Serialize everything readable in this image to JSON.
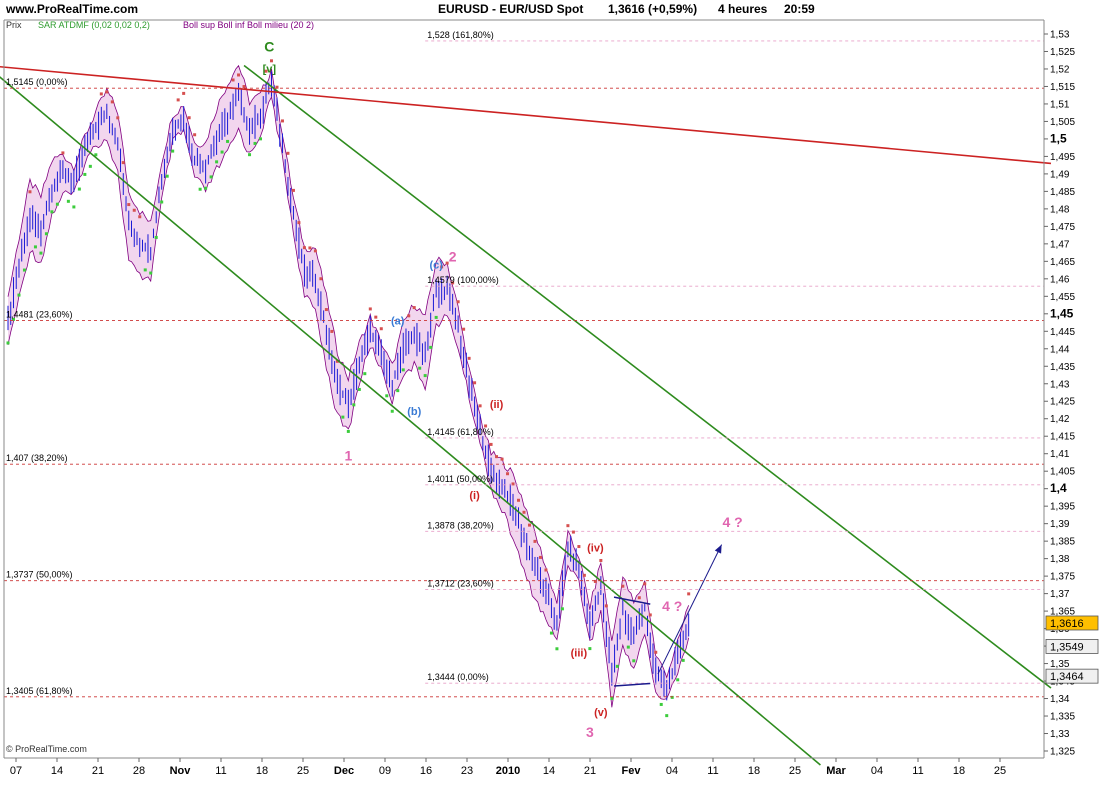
{
  "header": {
    "site": "www.ProRealTime.com",
    "instrument": "EURUSD - EUR/USD Spot",
    "quote": "1,3616 (+0,59%)",
    "timeframe": "4 heures",
    "time": "20:59"
  },
  "footer": {
    "copyright": "© ProRealTime.com"
  },
  "legend": {
    "price": "Prix",
    "sar": "SAR ATDMF (0,02 0,02 0,2)",
    "boll": "Boll sup Boll inf Boll milieu (20 2)"
  },
  "colors": {
    "candles": "#1a1ad6",
    "boll_fill": "#f2d6ee",
    "boll_line": "#800080",
    "sar_bear": "#d65050",
    "sar_bull": "#3ccc3c",
    "channel": "#2e8b1e",
    "resistance": "#cc2222",
    "fib_line": "#cc3333",
    "wave_pink": "#e066b0",
    "wave_red": "#cc2222",
    "wave_blue": "#3a7bd5",
    "wave_green": "#2e8b1e",
    "arrow": "#1a1a8c"
  },
  "chart_data": {
    "type": "candlestick",
    "title": "EURUSD - EUR/USD Spot",
    "x_ticks": [
      "07",
      "14",
      "21",
      "28",
      "Nov",
      "11",
      "18",
      "25",
      "Dec",
      "09",
      "16",
      "23",
      "2010",
      "14",
      "21",
      "Fev",
      "04",
      "11",
      "18",
      "25",
      "Mar",
      "04",
      "11",
      "18",
      "25"
    ],
    "y_ticks": [
      "1,53",
      "1,525",
      "1,52",
      "1,515",
      "1,51",
      "1,505",
      "1,5",
      "1,495",
      "1,49",
      "1,485",
      "1,48",
      "1,475",
      "1,47",
      "1,465",
      "1,46",
      "1,455",
      "1,45",
      "1,445",
      "1,44",
      "1,435",
      "1,43",
      "1,425",
      "1,42",
      "1,415",
      "1,41",
      "1,405",
      "1,4",
      "1,395",
      "1,39",
      "1,385",
      "1,38",
      "1,375",
      "1,37",
      "1,365",
      "1,36",
      "1,355",
      "1,35",
      "1,345",
      "1,34",
      "1,335",
      "1,33",
      "1,325"
    ],
    "y_bold_ticks": [
      "1,5",
      "1,45",
      "1,4"
    ],
    "ylim": [
      1.323,
      1.534
    ],
    "grid": false,
    "price_path": [
      [
        0,
        1.448
      ],
      [
        1,
        1.463
      ],
      [
        2,
        1.478
      ],
      [
        3,
        1.474
      ],
      [
        4,
        1.486
      ],
      [
        5,
        1.49
      ],
      [
        6,
        1.488
      ],
      [
        7,
        1.497
      ],
      [
        8,
        1.503
      ],
      [
        9,
        1.507
      ],
      [
        10,
        1.499
      ],
      [
        11,
        1.475
      ],
      [
        12,
        1.47
      ],
      [
        13,
        1.468
      ],
      [
        14,
        1.488
      ],
      [
        15,
        1.503
      ],
      [
        16,
        1.506
      ],
      [
        17,
        1.494
      ],
      [
        18,
        1.492
      ],
      [
        19,
        1.5
      ],
      [
        20,
        1.506
      ],
      [
        21,
        1.512
      ],
      [
        22,
        1.503
      ],
      [
        23,
        1.507
      ],
      [
        24,
        1.516
      ],
      [
        25,
        1.498
      ],
      [
        26,
        1.478
      ],
      [
        27,
        1.462
      ],
      [
        28,
        1.46
      ],
      [
        29,
        1.445
      ],
      [
        30,
        1.43
      ],
      [
        31,
        1.424
      ],
      [
        32,
        1.436
      ],
      [
        33,
        1.445
      ],
      [
        34,
        1.438
      ],
      [
        35,
        1.43
      ],
      [
        36,
        1.44
      ],
      [
        37,
        1.444
      ],
      [
        38,
        1.439
      ],
      [
        39,
        1.456
      ],
      [
        40,
        1.457
      ],
      [
        41,
        1.446
      ],
      [
        42,
        1.43
      ],
      [
        43,
        1.417
      ],
      [
        44,
        1.405
      ],
      [
        45,
        1.401
      ],
      [
        46,
        1.395
      ],
      [
        47,
        1.386
      ],
      [
        48,
        1.378
      ],
      [
        49,
        1.37
      ],
      [
        50,
        1.362
      ],
      [
        51,
        1.383
      ],
      [
        52,
        1.377
      ],
      [
        53,
        1.361
      ],
      [
        54,
        1.372
      ],
      [
        55,
        1.347
      ],
      [
        56,
        1.365
      ],
      [
        57,
        1.358
      ],
      [
        58,
        1.366
      ],
      [
        59,
        1.347
      ],
      [
        60,
        1.343
      ],
      [
        61,
        1.352
      ],
      [
        62,
        1.362
      ]
    ],
    "price_path_end_index": 62,
    "lines": [
      {
        "name": "channel-upper",
        "kind": "channel",
        "from": [
          21.5,
          1.521
        ],
        "to": [
          95,
          1.343
        ]
      },
      {
        "name": "channel-lower",
        "kind": "channel",
        "from": [
          -2,
          1.521
        ],
        "to": [
          74,
          1.321
        ]
      },
      {
        "name": "resistance",
        "kind": "resistance",
        "from": [
          -2,
          1.521
        ],
        "to": [
          95,
          1.493
        ]
      }
    ],
    "fib_left": [
      {
        "label": "1,5145 (0,00%)",
        "y": 1.5145
      },
      {
        "label": "1,4481 (23,60%)",
        "y": 1.4481
      },
      {
        "label": "1,407 (38,20%)",
        "y": 1.407
      },
      {
        "label": "1,3737 (50,00%)",
        "y": 1.3737
      },
      {
        "label": "1,3405 (61,80%)",
        "y": 1.3405
      }
    ],
    "fib_right": [
      {
        "label": "1,528 (161,80%)",
        "y": 1.528
      },
      {
        "label": "1,4579 (100,00%)",
        "y": 1.4579
      },
      {
        "label": "1,4145 (61,80%)",
        "y": 1.4145
      },
      {
        "label": "1,4011 (50,00%)",
        "y": 1.4011
      },
      {
        "label": "1,3878 (38,20%)",
        "y": 1.3878
      },
      {
        "label": "1,3712 (23,60%)",
        "y": 1.3712
      },
      {
        "label": "1,3444 (0,00%)",
        "y": 1.3444
      }
    ],
    "wave_labels": [
      {
        "text": "C",
        "color": "green",
        "x": 23.8,
        "y": 1.525
      },
      {
        "text": "[v]",
        "color": "green",
        "x": 23.8,
        "y": 1.519
      },
      {
        "text": "(a)",
        "color": "blue",
        "x": 35.5,
        "y": 1.447
      },
      {
        "text": "(b)",
        "color": "blue",
        "x": 37,
        "y": 1.421
      },
      {
        "text": "(c)",
        "color": "blue",
        "x": 39,
        "y": 1.463
      },
      {
        "text": "2",
        "color": "pink",
        "x": 40.5,
        "y": 1.465
      },
      {
        "text": "1",
        "color": "pink",
        "x": 31,
        "y": 1.408
      },
      {
        "text": "(ii)",
        "color": "red",
        "x": 44.5,
        "y": 1.423
      },
      {
        "text": "(i)",
        "color": "red",
        "x": 42.5,
        "y": 1.397
      },
      {
        "text": "(iv)",
        "color": "red",
        "x": 53.5,
        "y": 1.382
      },
      {
        "text": "(iii)",
        "color": "red",
        "x": 52,
        "y": 1.352
      },
      {
        "text": "(v)",
        "color": "red",
        "x": 54,
        "y": 1.335
      },
      {
        "text": "3",
        "color": "pink",
        "x": 53,
        "y": 1.329
      },
      {
        "text": "4 ?",
        "color": "pink",
        "x": 60.5,
        "y": 1.365
      },
      {
        "text": "4 ?",
        "color": "pink",
        "x": 66,
        "y": 1.389
      }
    ],
    "last_values": [
      {
        "label": "1,3616",
        "y": 1.3616
      },
      {
        "label": "1,3549",
        "y": 1.3549
      },
      {
        "label": "1,3464",
        "y": 1.3464
      }
    ]
  }
}
